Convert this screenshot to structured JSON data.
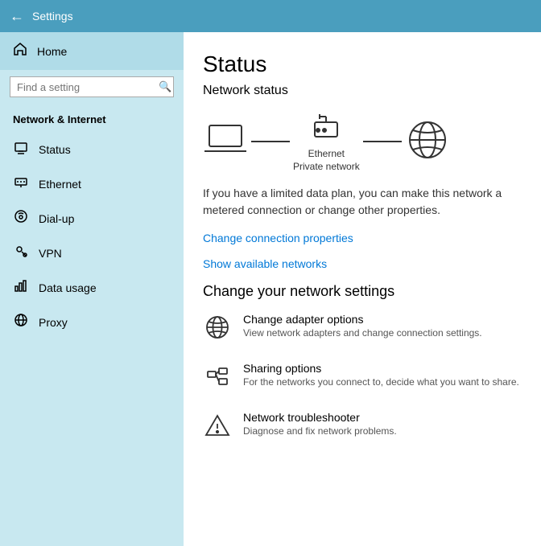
{
  "topbar": {
    "title": "Settings",
    "back_icon": "←"
  },
  "sidebar": {
    "home_label": "Home",
    "search_placeholder": "Find a setting",
    "section_title": "Network & Internet",
    "items": [
      {
        "id": "status",
        "label": "Status",
        "icon": "🖥"
      },
      {
        "id": "ethernet",
        "label": "Ethernet",
        "icon": "🔌"
      },
      {
        "id": "dialup",
        "label": "Dial-up",
        "icon": "📞"
      },
      {
        "id": "vpn",
        "label": "VPN",
        "icon": "🔑"
      },
      {
        "id": "data-usage",
        "label": "Data usage",
        "icon": "📊"
      },
      {
        "id": "proxy",
        "label": "Proxy",
        "icon": "🌐"
      }
    ]
  },
  "content": {
    "page_title": "Status",
    "network_status_title": "Network status",
    "ethernet_label": "Ethernet",
    "network_type": "Private network",
    "info_text": "If you have a limited data plan, you can make this network a metered connection or change other properties.",
    "change_connection_link": "Change connection properties",
    "show_networks_link": "Show available networks",
    "change_section_title": "Change your network settings",
    "settings_items": [
      {
        "id": "adapter",
        "title": "Change adapter options",
        "desc": "View network adapters and change connection settings."
      },
      {
        "id": "sharing",
        "title": "Sharing options",
        "desc": "For the networks you connect to, decide what you want to share."
      },
      {
        "id": "troubleshooter",
        "title": "Network troubleshooter",
        "desc": "Diagnose and fix network problems."
      }
    ]
  }
}
